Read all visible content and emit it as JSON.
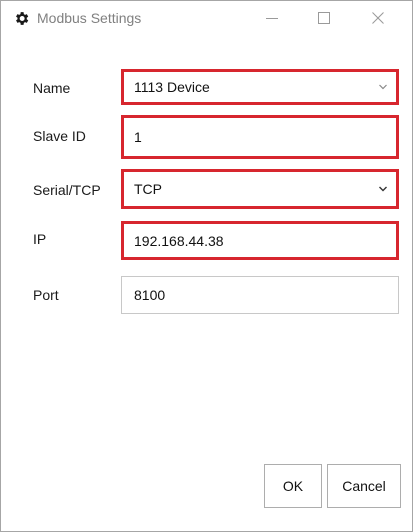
{
  "window": {
    "title": "Modbus Settings",
    "icon": "gear-icon",
    "controls": [
      "minimize-icon",
      "maximize-icon",
      "close-icon"
    ]
  },
  "form": {
    "name": {
      "label": "Name",
      "value": "1113 Device"
    },
    "slave_id": {
      "label": "Slave ID",
      "value": "1"
    },
    "mode": {
      "label": "Serial/TCP",
      "value": "TCP"
    },
    "ip": {
      "label": "IP",
      "value": "192.168.44.38"
    },
    "port": {
      "label": "Port",
      "value": "8100"
    }
  },
  "buttons": {
    "ok": "OK",
    "cancel": "Cancel"
  },
  "colors": {
    "highlight": "#d7262e",
    "border": "#c8c8c8"
  }
}
